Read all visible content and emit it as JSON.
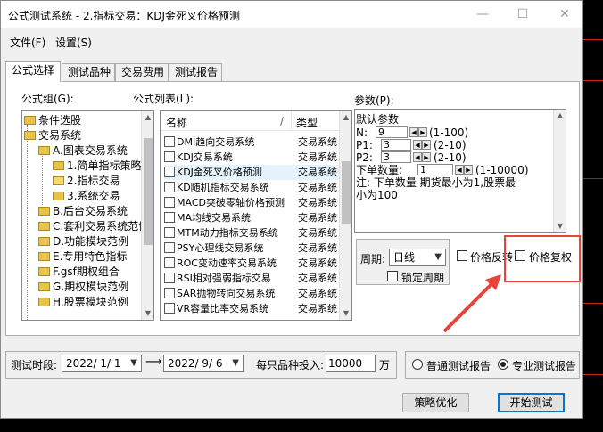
{
  "window": {
    "title": "公式测试系统 - 2.指标交易：KDJ金死叉价格预测"
  },
  "menu": [
    "文件(F)",
    "设置(S)"
  ],
  "tabs": [
    "公式选择",
    "测试品种",
    "交易费用",
    "测试报告"
  ],
  "formula_group": {
    "label": "公式组(G):",
    "items": [
      "条件选股",
      "交易系统",
      "A.图表交易系统",
      "1.简单指标策略",
      "2.指标交易",
      "3.系统交易",
      "B.后台交易系统",
      "C.套利交易系统范例",
      "D.功能模块范例",
      "E.专用特色指标",
      "F.gsf期权组合",
      "G.期权模块范例",
      "H.股票模块范例"
    ]
  },
  "formula_list": {
    "label": "公式列表(L):",
    "columns": [
      "名称",
      "/",
      "类型"
    ],
    "rows": [
      {
        "name": "DMI趋向交易系统",
        "type": "交易系统"
      },
      {
        "name": "KDJ交易系统",
        "type": "交易系统"
      },
      {
        "name": "KDJ金死叉价格预测",
        "type": "交易系统"
      },
      {
        "name": "KD随机指标交易系统",
        "type": "交易系统"
      },
      {
        "name": "MACD突破零轴价格预测",
        "type": "交易系统"
      },
      {
        "name": "MA均线交易系统",
        "type": "交易系统"
      },
      {
        "name": "MTM动力指标交易系统",
        "type": "交易系统"
      },
      {
        "name": "PSY心理线交易系统",
        "type": "交易系统"
      },
      {
        "name": "ROC变动速率交易系统",
        "type": "交易系统"
      },
      {
        "name": "RSI相对强弱指标交易",
        "type": "交易系统"
      },
      {
        "name": "SAR抛物转向交易系统",
        "type": "交易系统"
      },
      {
        "name": "VR容量比率交易系统",
        "type": "交易系统"
      }
    ]
  },
  "params": {
    "label": "参数(P):",
    "heading": "默认参数",
    "n_label": "N:",
    "n_value": "9",
    "n_range": "(1-100)",
    "p1_label": "P1:",
    "p1_value": "3",
    "p1_range": "(2-10)",
    "p2_label": "P2:",
    "p2_value": "3",
    "p2_range": "(2-10)",
    "qty_label": "下单数量:",
    "qty_value": "1",
    "qty_range": "(1-10000)",
    "note_line1": "注: 下单数量 期货最小为1,股票最",
    "note_line2": "小为100"
  },
  "period": {
    "label": "周期:",
    "value": "日线",
    "lock_label": "锁定周期",
    "reverse_label": "价格反转",
    "adjust_label": "价格复权"
  },
  "bottom": {
    "range_label": "测试时段:",
    "start_date": "2022/ 1/ 1",
    "end_date": "2022/ 9/ 6",
    "invest_label": "每只品种投入:",
    "invest_value": "10000",
    "unit": "万",
    "normal_report": "普通测试报告",
    "pro_report": "专业测试报告"
  },
  "buttons": {
    "optimize": "策略优化",
    "start": "开始测试"
  },
  "colors": {
    "highlight": "#e8443a",
    "folder": "#e8c34a"
  }
}
